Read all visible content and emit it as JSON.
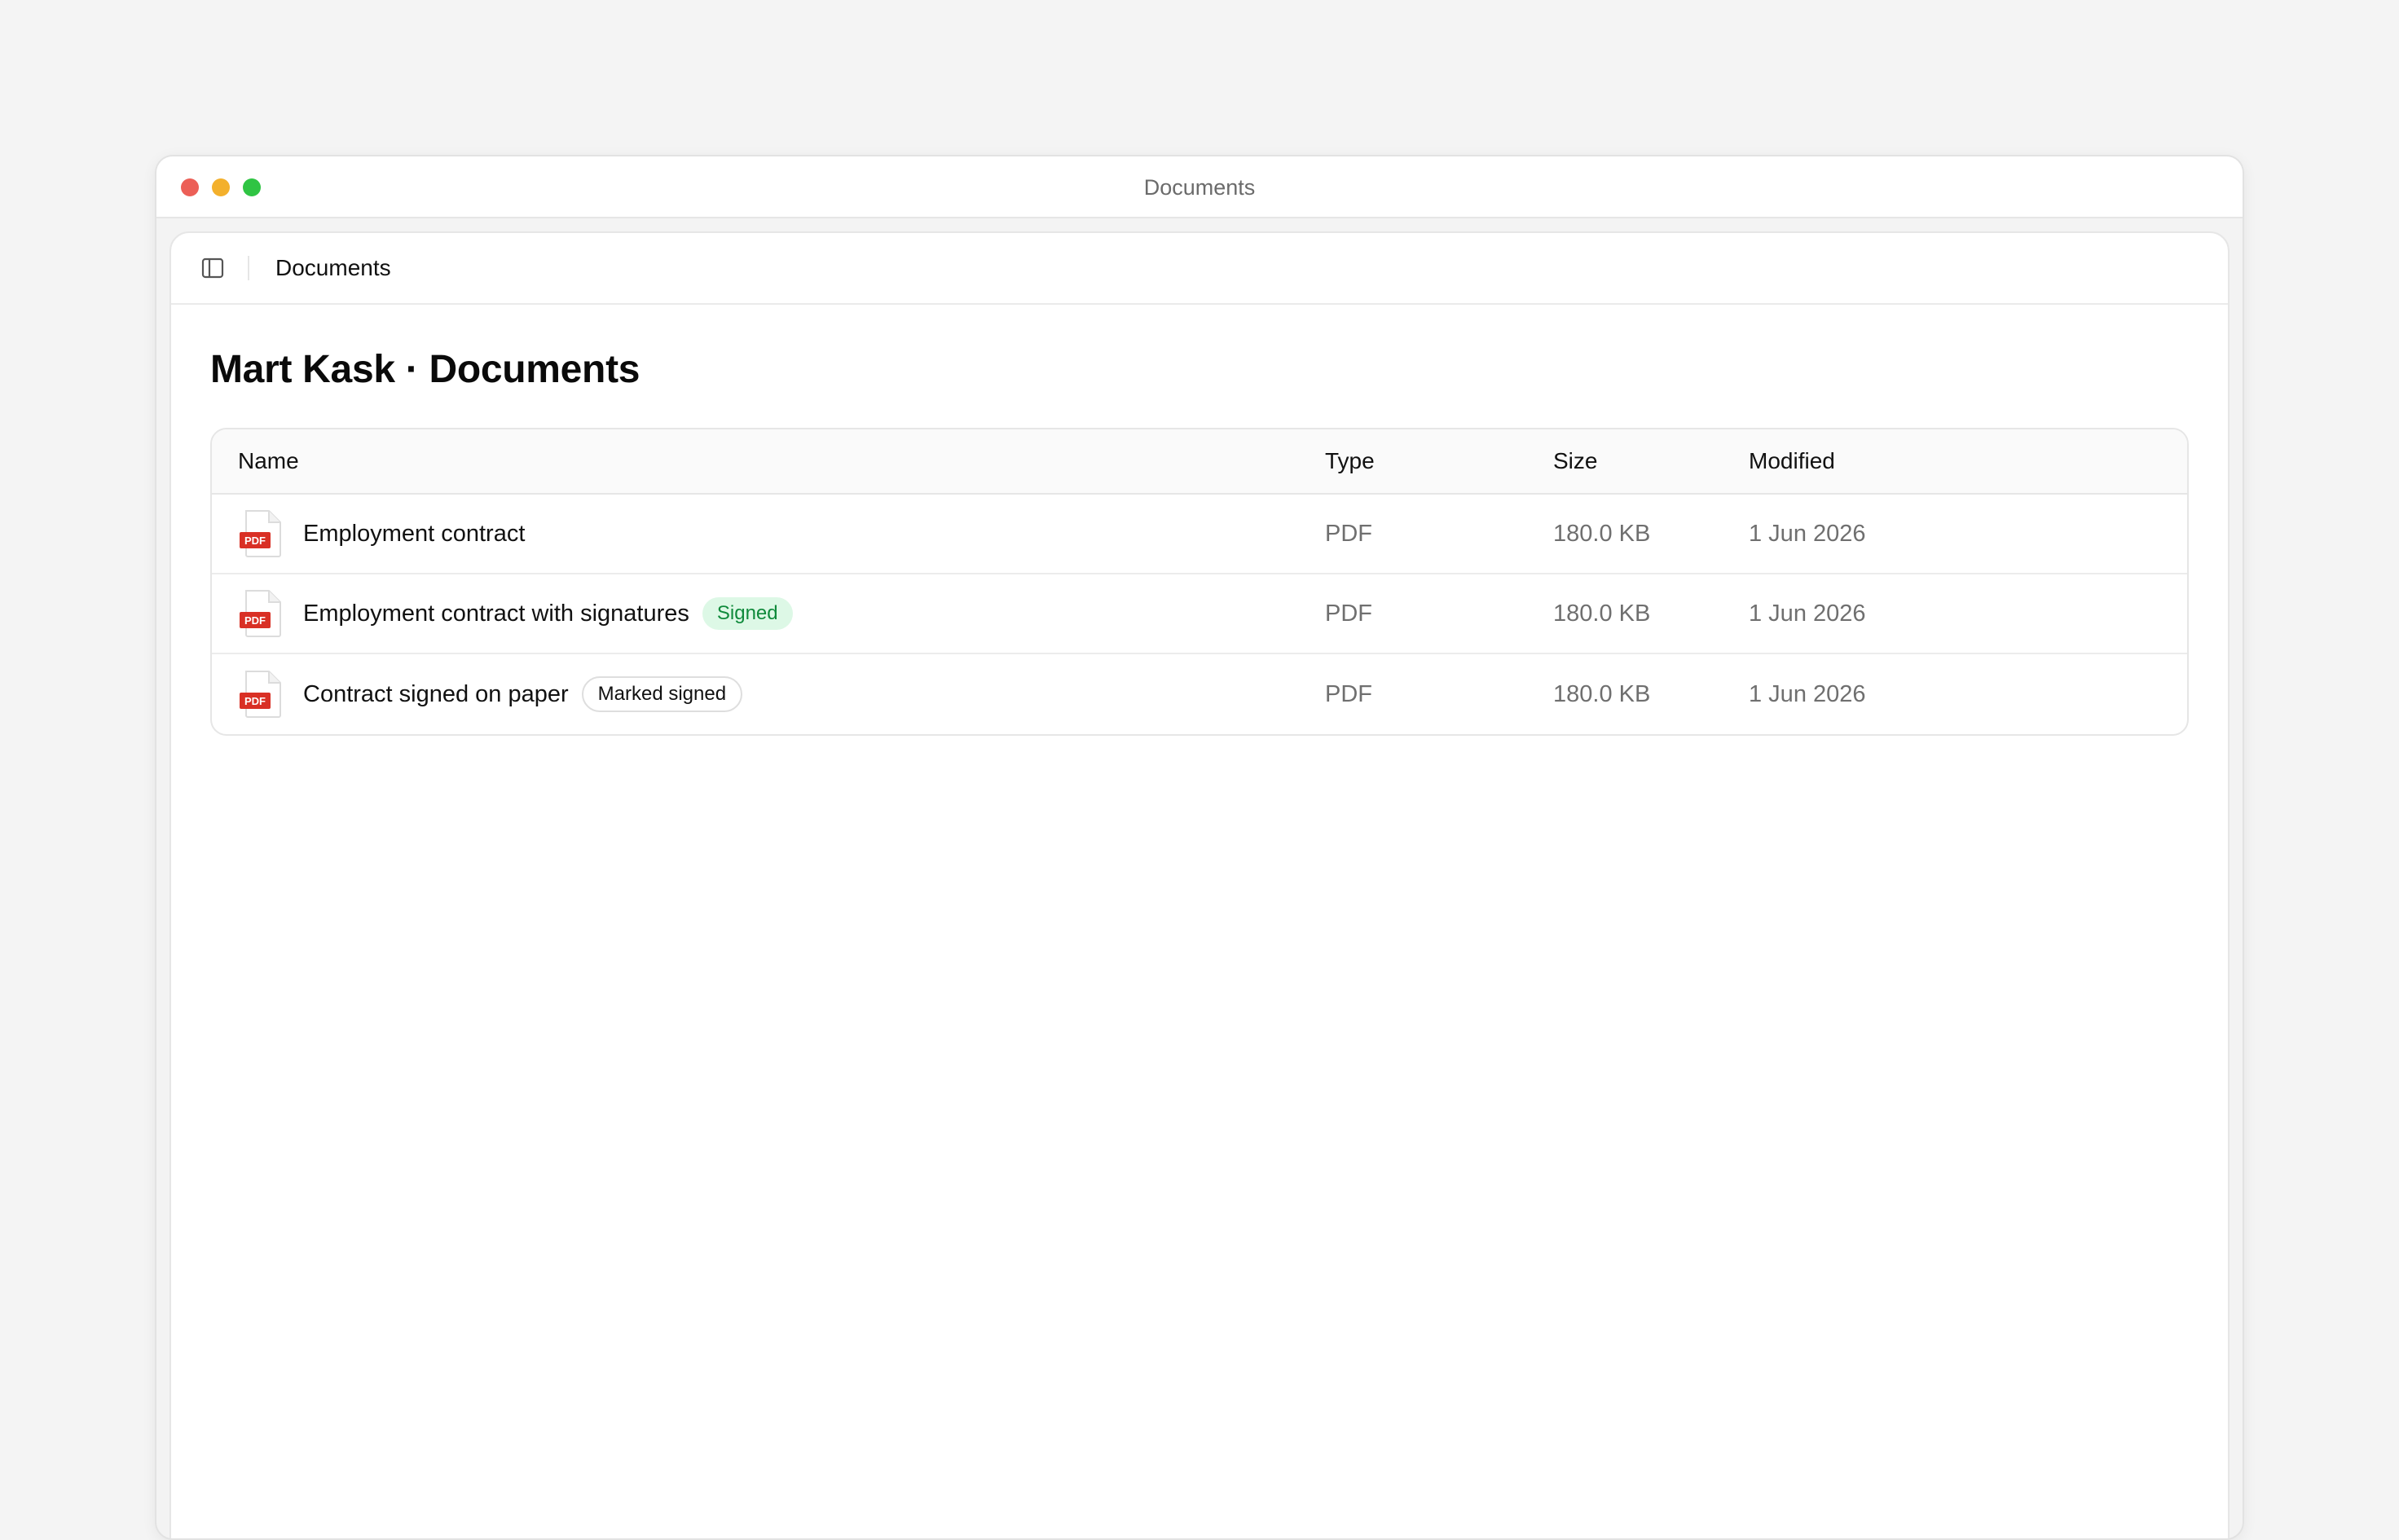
{
  "window": {
    "title": "Documents"
  },
  "topbar": {
    "breadcrumb": "Documents"
  },
  "page": {
    "title": "Mart Kask · Documents"
  },
  "table": {
    "columns": {
      "name": "Name",
      "type": "Type",
      "size": "Size",
      "modified": "Modified"
    },
    "rows": [
      {
        "name": "Employment contract",
        "badge": "",
        "type": "PDF",
        "size": "180.0 KB",
        "modified": "1 Jun 2026"
      },
      {
        "name": "Employment contract with signatures",
        "badge": "Signed",
        "type": "PDF",
        "size": "180.0 KB",
        "modified": "1 Jun 2026"
      },
      {
        "name": "Contract signed on paper",
        "badge": "Marked signed",
        "type": "PDF",
        "size": "180.0 KB",
        "modified": "1 Jun 2026"
      }
    ]
  },
  "icons": {
    "file": "pdf-file-icon",
    "sidebar": "sidebar-toggle-icon"
  },
  "colors": {
    "close": "#ec5f57",
    "minimize": "#f3b02c",
    "zoom": "#2fc443",
    "pdf_red": "#d93025",
    "signed_bg": "#ddf8e6",
    "signed_text": "#0f8a3b"
  }
}
